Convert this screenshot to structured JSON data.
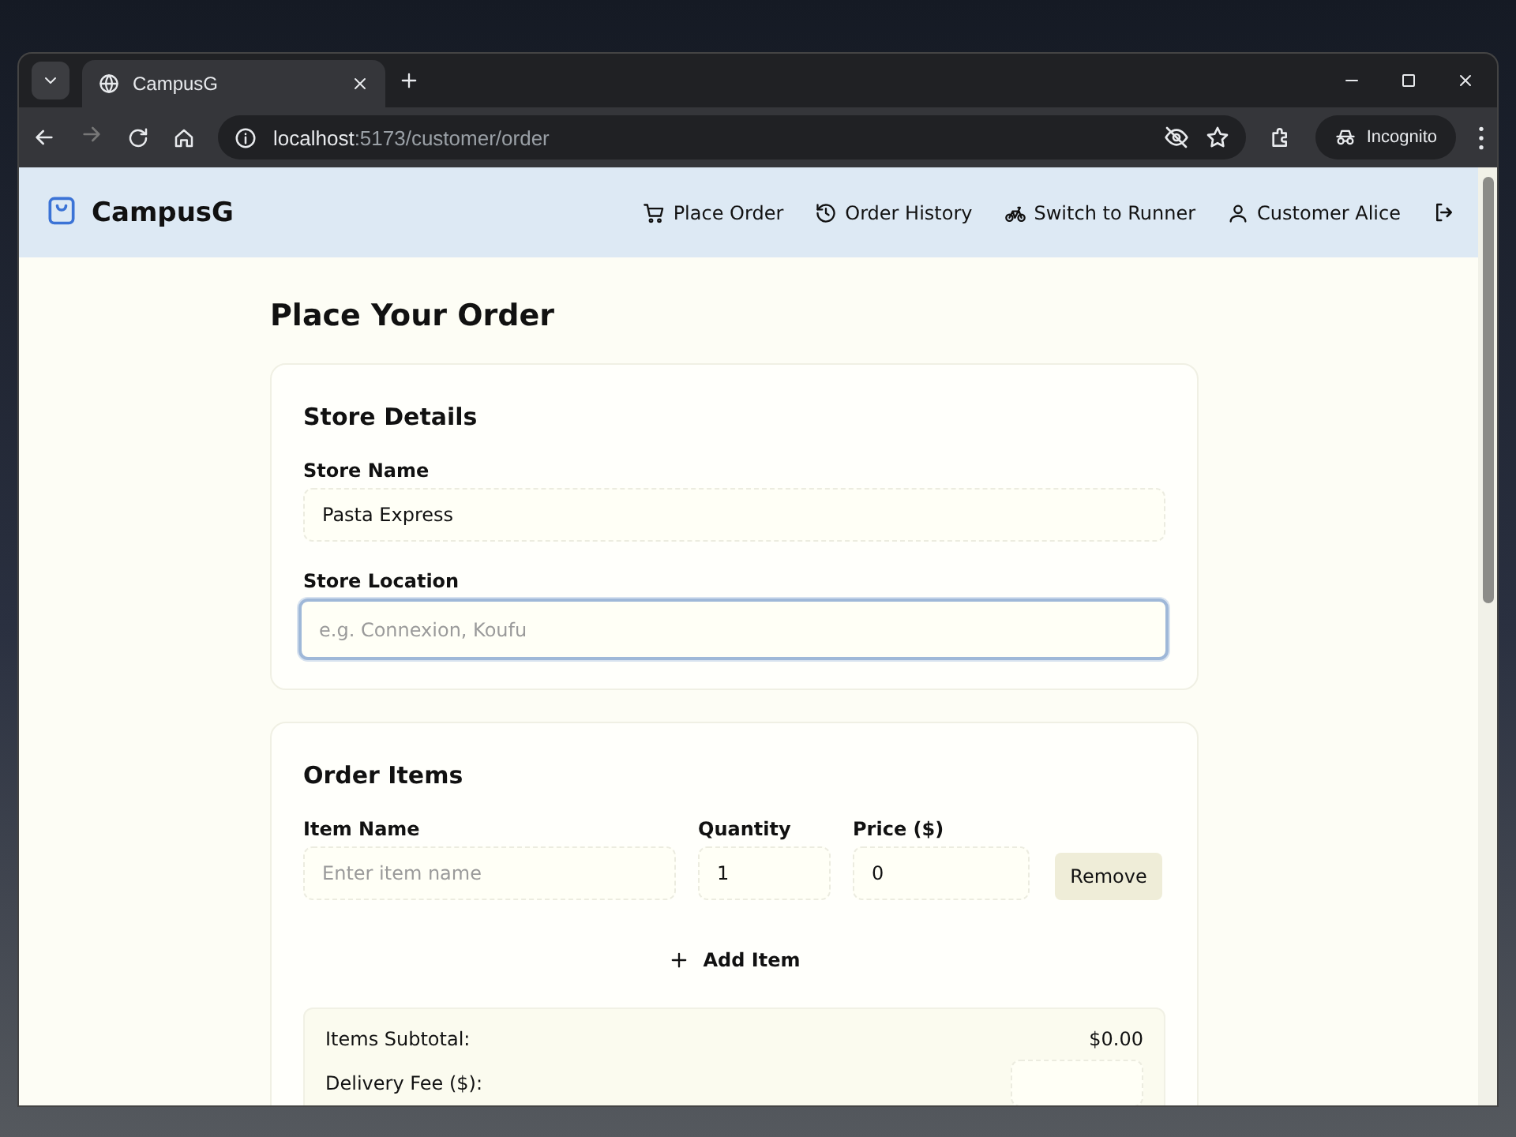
{
  "browser": {
    "tab": {
      "title": "CampusG"
    },
    "address": {
      "host": "localhost",
      "rest": ":5173/customer/order"
    },
    "profile": "Incognito"
  },
  "app": {
    "brand": "CampusG",
    "nav": [
      {
        "kind": "cart",
        "label": "Place Order"
      },
      {
        "kind": "history",
        "label": "Order History"
      },
      {
        "kind": "bike",
        "label": "Switch to Runner"
      },
      {
        "kind": "user",
        "label": "Customer Alice"
      }
    ]
  },
  "page": {
    "title": "Place Your Order",
    "store_details": {
      "heading": "Store Details",
      "fields": [
        {
          "label": "Store Name",
          "value": "Pasta Express",
          "focused": false
        },
        {
          "label": "Store Location",
          "placeholder": "e.g. Connexion, Koufu",
          "focused": true
        }
      ]
    },
    "order_items": {
      "heading": "Order Items",
      "columns": [
        "Item Name",
        "Quantity",
        "Price ($)"
      ],
      "items": [
        {
          "name_placeholder": "Enter item name",
          "quantity": "1",
          "price": "0",
          "remove_button": "Remove"
        }
      ],
      "add_button": "Add Item",
      "summary": [
        {
          "kind": "text",
          "label": "Items Subtotal:",
          "value": "$0.00"
        },
        {
          "kind": "input",
          "label": "Delivery Fee ($):"
        }
      ]
    }
  }
}
